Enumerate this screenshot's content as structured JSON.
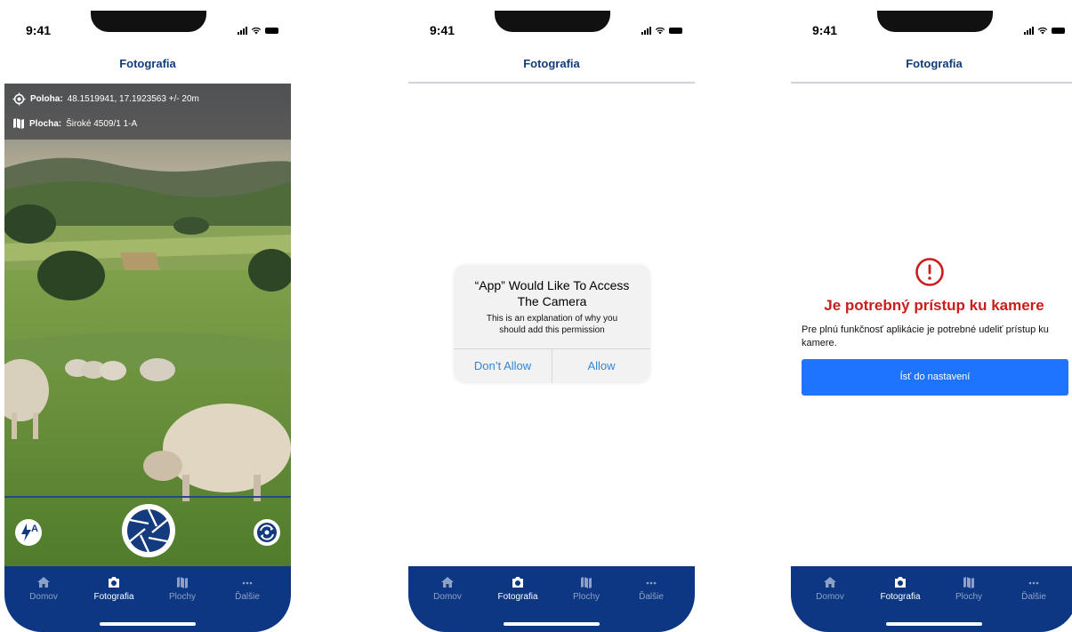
{
  "status": {
    "time": "9:41"
  },
  "header": {
    "title": "Fotografia"
  },
  "tabs": [
    {
      "label": "Domov",
      "icon": "home-icon"
    },
    {
      "label": "Fotografia",
      "icon": "camera-icon"
    },
    {
      "label": "Plochy",
      "icon": "map-icon"
    },
    {
      "label": "Ďalšie",
      "icon": "more-icon"
    }
  ],
  "colors": {
    "brand": "#0d3782",
    "header_text": "#103c7a",
    "error": "#cb1c1c",
    "primary_button": "#1e74ff",
    "dialog_button": "#2f87d6"
  },
  "camera": {
    "location_label": "Poloha:",
    "location_value": "48.1519941, 17.1923563 +/- 20m",
    "area_label": "Plocha:",
    "area_value": "Široké 4509/1 1-A",
    "flash_icon": "flash-auto-icon",
    "shutter_icon": "shutter-icon",
    "switch_icon": "switch-camera-icon"
  },
  "permission_dialog": {
    "title": "“App” Would Like To Access The Camera",
    "message": "This is an explanation of why you should add this permission",
    "deny_label": "Don’t Allow",
    "allow_label": "Allow"
  },
  "denied_screen": {
    "icon": "alert-circle-icon",
    "title": "Je potrebný prístup ku kamere",
    "message": "Pre plnú funkčnosť aplikácie je potrebné udeliť prístup ku kamere.",
    "button_label": "Ísť do nastavení"
  }
}
